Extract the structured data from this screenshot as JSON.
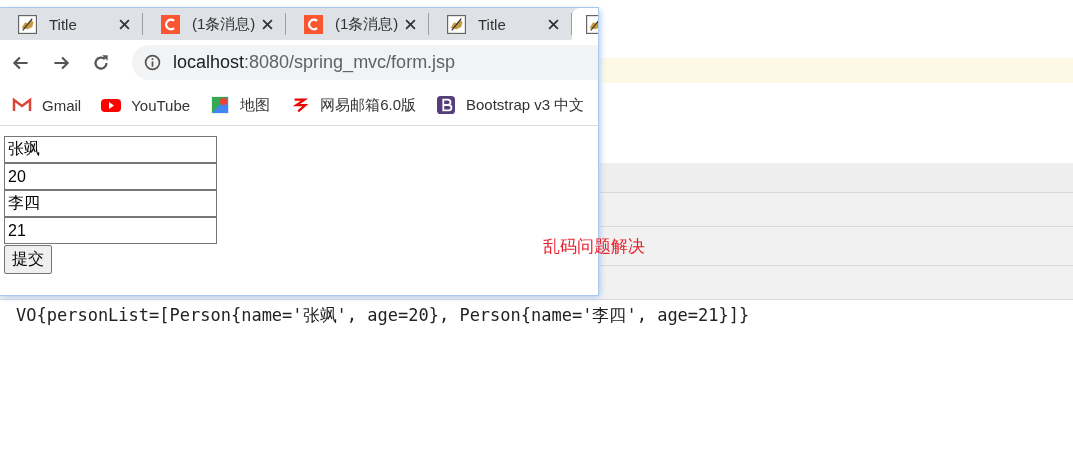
{
  "browser": {
    "tabs": [
      {
        "title": "Title",
        "kind": "tomcat",
        "selected": false
      },
      {
        "title": "(1条消息)",
        "kind": "blog",
        "selected": false
      },
      {
        "title": "(1条消息)",
        "kind": "blog",
        "selected": false
      },
      {
        "title": "Title",
        "kind": "tomcat",
        "selected": false
      },
      {
        "kind": "tomcat",
        "selected": true
      }
    ],
    "address": {
      "host": "localhost",
      "path": ":8080/spring_mvc/form.jsp"
    },
    "bookmarks": [
      {
        "label": "Gmail",
        "kind": "mail"
      },
      {
        "label": "YouTube",
        "kind": "video"
      },
      {
        "label": "地图",
        "kind": "map"
      },
      {
        "label": "网易邮箱6.0版",
        "kind": "netmail"
      },
      {
        "label": "Bootstrap v3 中文",
        "kind": "docs"
      }
    ],
    "form": {
      "fields": [
        "张飒",
        "20",
        "李四",
        "21"
      ],
      "submit": "提交"
    }
  },
  "page": {
    "notice": "乱码问题解决",
    "output": "VO{personList=[Person{name='张飒', age=20}, Person{name='李四', age=21}]}"
  }
}
